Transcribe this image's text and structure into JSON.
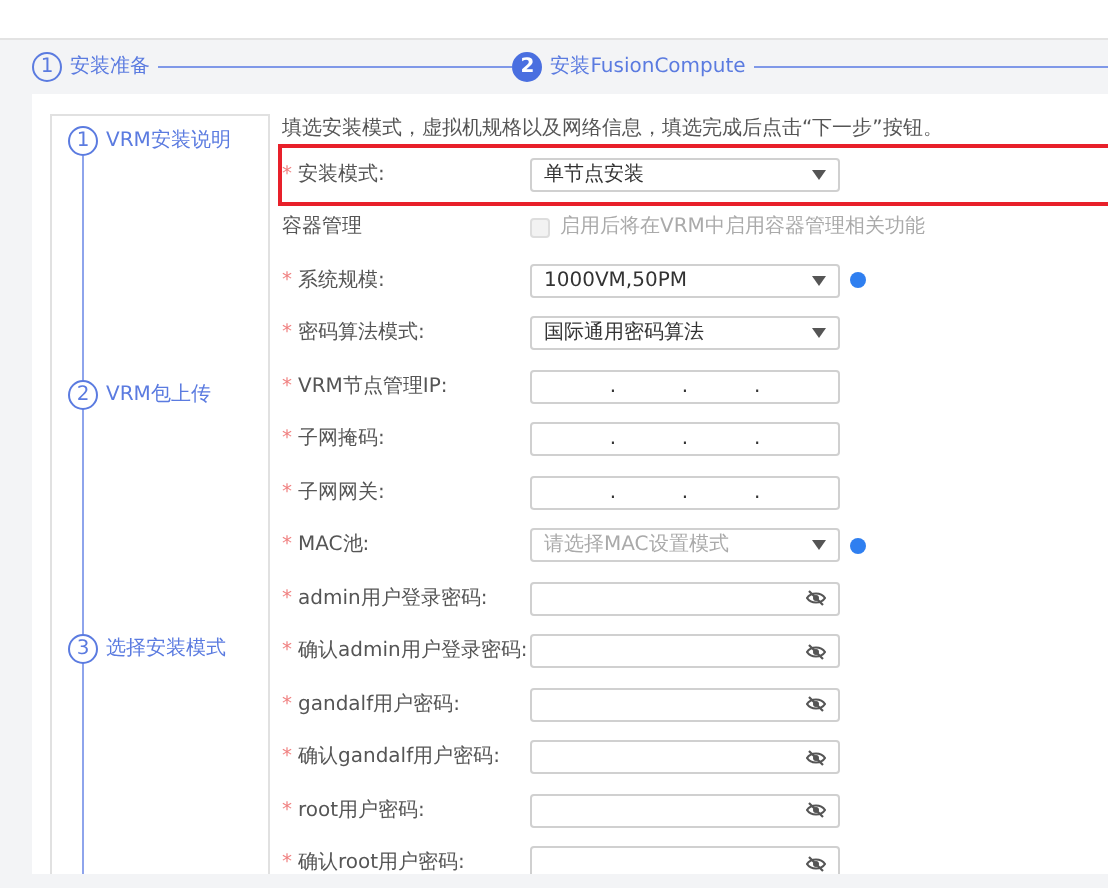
{
  "steps": [
    {
      "number": "1",
      "label": "安装准备",
      "active": false
    },
    {
      "number": "2",
      "label": "安装FusionCompute",
      "active": true
    }
  ],
  "side_steps": [
    {
      "number": "1",
      "label": "VRM安装说明"
    },
    {
      "number": "2",
      "label": "VRM包上传"
    },
    {
      "number": "3",
      "label": "选择安装模式"
    }
  ],
  "intro": "填选安装模式，虚拟机规格以及网络信息，填选完成后点击“下一步”按钮。",
  "fields": [
    {
      "kind": "select",
      "label": "安装模式:",
      "required_mark": "*",
      "highlighted": true,
      "value": "单节点安装",
      "info": false
    },
    {
      "kind": "checkbox",
      "label": "容器管理",
      "highlighted": false,
      "text": "启用后将在VRM中启用容器管理相关功能",
      "checked": false,
      "disabled": true
    },
    {
      "kind": "select",
      "label": "系统规模:",
      "required_mark": "*",
      "highlighted": false,
      "value": "1000VM,50PM",
      "info": true
    },
    {
      "kind": "select",
      "label": "密码算法模式:",
      "required_mark": "*",
      "highlighted": false,
      "value": "国际通用密码算法",
      "info": false
    },
    {
      "kind": "ip",
      "label": "VRM节点管理IP:",
      "required_mark": "*",
      "highlighted": false,
      "separators": [
        ".",
        ".",
        "."
      ]
    },
    {
      "kind": "ip",
      "label": "子网掩码:",
      "required_mark": "*",
      "highlighted": false,
      "separators": [
        ".",
        ".",
        "."
      ]
    },
    {
      "kind": "ip",
      "label": "子网网关:",
      "required_mark": "*",
      "highlighted": false,
      "separators": [
        ".",
        ".",
        "."
      ]
    },
    {
      "kind": "select",
      "label": "MAC池:",
      "required_mark": "*",
      "highlighted": false,
      "placeholder": "请选择MAC设置模式",
      "info": true
    },
    {
      "kind": "password",
      "label": "admin用户登录密码:",
      "required_mark": "*",
      "highlighted": false
    },
    {
      "kind": "password",
      "label": "确认admin用户登录密码:",
      "required_mark": "*",
      "highlighted": false
    },
    {
      "kind": "password",
      "label": "gandalf用户密码:",
      "required_mark": "*",
      "highlighted": false
    },
    {
      "kind": "password",
      "label": "确认gandalf用户密码:",
      "required_mark": "*",
      "highlighted": false
    },
    {
      "kind": "password",
      "label": "root用户密码:",
      "required_mark": "*",
      "highlighted": false
    },
    {
      "kind": "password",
      "label": "确认root用户密码:",
      "required_mark": "*",
      "highlighted": false
    }
  ]
}
